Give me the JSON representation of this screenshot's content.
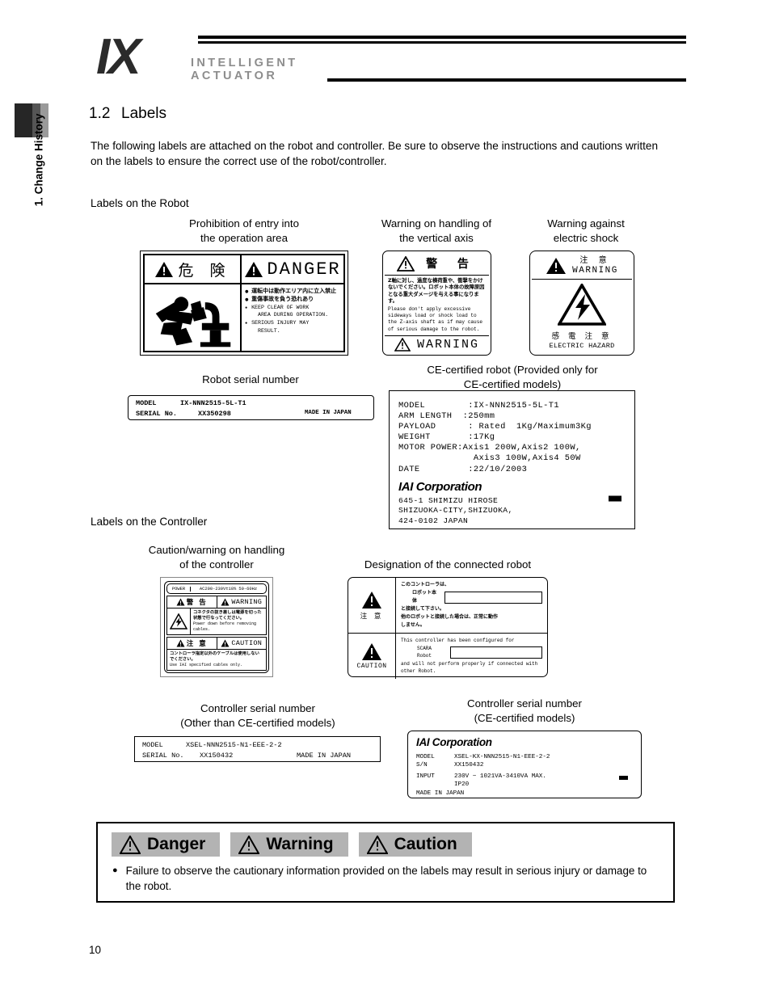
{
  "sidebar": {
    "chapter_label": "1. Change History"
  },
  "header": {
    "logo": "IX",
    "logo_line1": "INTELLIGENT",
    "logo_line2": "ACTUATOR"
  },
  "section": {
    "number": "1.2",
    "title": "Labels",
    "intro": "The following labels are attached on the robot and controller. Be sure to observe the instructions and cautions written on the labels to ensure the correct use of the robot/controller.",
    "head_robot": "Labels on the Robot",
    "head_controller": "Labels on the Controller"
  },
  "captions": {
    "danger": "Prohibition of entry into\nthe operation area",
    "vertical_axis": "Warning on handling of\nthe vertical axis",
    "electric_shock": "Warning against\nelectric shock",
    "robot_serial": "Robot serial number",
    "ce_robot": "CE-certified robot (Provided only for\nCE-certified models)",
    "controller_caution": "Caution/warning on handling\nof the controller",
    "designation": "Designation of the connected robot",
    "controller_serial": "Controller serial number\n(Other than CE-certified models)",
    "controller_serial_ce": "Controller serial number\n(CE-certified models)"
  },
  "label_danger": {
    "head_jp": "危 険",
    "head_en": "DANGER",
    "bullets_jp": [
      "運転中は動作エリア内に立入禁止",
      "重傷事故を負う恐れあり"
    ],
    "bullets_en": [
      "KEEP CLEAR OF WORK\n  AREA DURING OPERATION.",
      "SERIOUS INJURY MAY\n  RESULT."
    ]
  },
  "label_vertical_axis": {
    "head_jp": "警 告",
    "body_jp": "Z軸に対し、過度な横荷重や、衝撃をかけないでください。ロボット本体の故障原因となる重大ダメージを与える事になります。",
    "body_en": "Please don't apply excessive sideways load or shock load to the Z-axis shaft as if may cause of serious damage to the robot.",
    "foot_en": "WARNING"
  },
  "label_electric_shock": {
    "head_jp": "注 意",
    "head_en": "WARNING",
    "foot_jp": "感 電 注 意",
    "foot_en": "ELECTRIC HAZARD"
  },
  "label_robot_serial": {
    "model_key": "MODEL",
    "model_value": "IX-NNN2515-5L-T1",
    "serial_key": "SERIAL No.",
    "serial_value": "XX350298",
    "origin": "MADE IN JAPAN"
  },
  "label_ce_robot": {
    "spec_lines": [
      "MODEL        :IX-NNN2515-5L-T1",
      "ARM LENGTH  :250mm",
      "PAYLOAD      : Rated  1Kg/Maximum3Kg",
      "WEIGHT       :17Kg",
      "MOTOR POWER:Axis1 200W,Axis2 100W,",
      "              Axis3 100W,Axis4 50W",
      "DATE         :22/10/2003"
    ],
    "company": "IAI Corporation",
    "address_lines": [
      "645-1 SHIMIZU HIROSE",
      "SHIZUOKA-CITY,SHIZUOKA,",
      "424-0102 JAPAN"
    ],
    "ce_mark": "CE"
  },
  "label_controller_caution": {
    "power_key": "POWER",
    "power_value": "AC200-230V±10% 50-60Hz",
    "warning_jp": "警 告",
    "warning_en": "WARNING",
    "warning_body_jp": "コネクタの抜き差しは電源を切った状態で行なってください。",
    "warning_body_en": "Power down before removing cables.",
    "caution_jp": "注 意",
    "caution_en": "CAUTION",
    "caution_body_jp": "コントローラ指定以外のケーブルは使用しないでください。",
    "caution_body_en": "Use IAI specified cables only."
  },
  "label_designation": {
    "caution_jp": "注 意",
    "caution_en": "CAUTION",
    "jp_line1": "このコントローラは、",
    "jp_field_label": "ロボット本体",
    "jp_line2": "と接続して下さい。",
    "jp_line3": "他のロボットと接続した場合は、正常に動作",
    "jp_line4": "しません。",
    "en_line1": "This controller has been configured for",
    "en_field_label": "SCARA Robot",
    "en_line2": "and will not perform properly if connected with",
    "en_line3": "other Robot."
  },
  "label_controller_serial": {
    "model_key": "MODEL",
    "model_value": "XSEL-NNN2515-N1-EEE-2-2",
    "serial_key": "SERIAL No.",
    "serial_value": "XX150432",
    "origin": "MADE IN JAPAN"
  },
  "label_controller_serial_ce": {
    "company": "IAI Corporation",
    "model_key": "MODEL",
    "model_value": "XSEL-KX-NNN2515-N1-EEE-2-2",
    "sn_key": "S/N",
    "sn_value": "XX150432",
    "input_key": "INPUT",
    "input_value": "230V ~ 1021VA-3410VA MAX.",
    "ip_value": "IP20",
    "origin": "MADE IN JAPAN",
    "ce_mark": "CE"
  },
  "notice": {
    "chips": [
      "Danger",
      "Warning",
      "Caution"
    ],
    "bullet": "●",
    "text": "Failure to observe the cautionary information provided on the labels may result in serious injury or damage to the robot."
  },
  "page_number": "10"
}
